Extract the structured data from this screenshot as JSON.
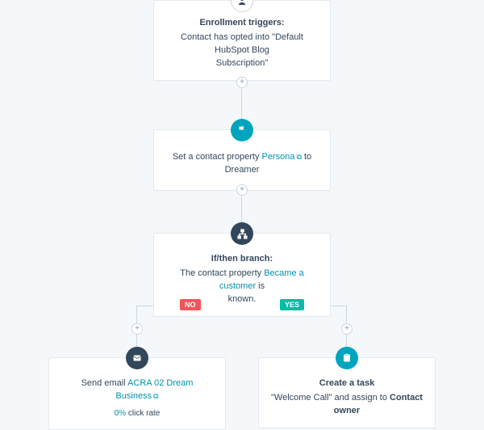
{
  "enroll": {
    "title": "Enrollment triggers:",
    "text_a": "Contact has opted into \"Default HubSpot Blog",
    "text_b": "Subscription\""
  },
  "setProp": {
    "prefix": "Set a contact property ",
    "link": "Persona",
    "suffix": " to Dreamer"
  },
  "branch": {
    "title": "If/then branch:",
    "prefix": "The contact property ",
    "link": "Became a customer",
    "suffix": " is",
    "tail": "known.",
    "no": "NO",
    "yes": "YES"
  },
  "email": {
    "prefix": "Send email ",
    "link": "ACRA 02 Dream Business",
    "rate_val": "0%",
    "rate_label": " click rate"
  },
  "task": {
    "title": "Create a task",
    "prefix": "\"Welcome Call\" and assign to ",
    "owner": "Contact owner"
  },
  "glyphs": {
    "plus": "+"
  }
}
